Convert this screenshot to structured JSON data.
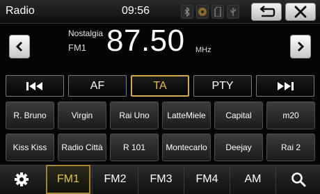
{
  "header": {
    "title": "Radio",
    "time": "09:56",
    "status_icons": [
      "bluetooth-icon",
      "disc-icon",
      "sd-card-icon",
      "usb-icon"
    ],
    "back_icon": "back-arrow-icon",
    "close_icon": "close-icon"
  },
  "tuner": {
    "station_name": "Nostalgia",
    "band": "FM1",
    "frequency": "87.50",
    "unit": "MHz",
    "prev_icon": "chevron-left-icon",
    "next_icon": "chevron-right-icon"
  },
  "controls": {
    "seek_back_icon": "skip-previous-icon",
    "af": "AF",
    "ta": "TA",
    "pty": "PTY",
    "seek_forward_icon": "skip-next-icon"
  },
  "presets": {
    "row1": [
      "R. Bruno",
      "Virgin",
      "Rai Uno",
      "LatteMiele",
      "Capital",
      "m20"
    ],
    "row2": [
      "Kiss Kiss",
      "Radio Città",
      "R 101",
      "Montecarlo",
      "Deejay",
      "Rai 2"
    ]
  },
  "bottom": {
    "settings_icon": "gear-icon",
    "bands": [
      "FM1",
      "FM2",
      "FM3",
      "FM4",
      "AM"
    ],
    "search_icon": "search-icon"
  },
  "colors": {
    "accent": "#e7b94a",
    "background": "#050505"
  }
}
